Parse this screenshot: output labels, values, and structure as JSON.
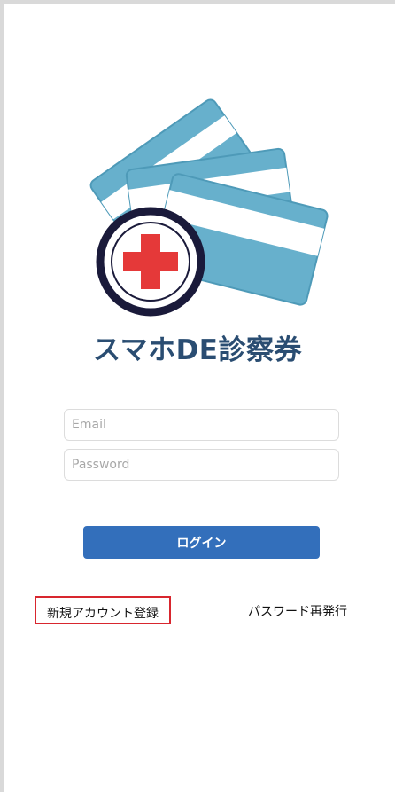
{
  "app": {
    "title": "スマホDE診察券"
  },
  "login_form": {
    "email_placeholder": "Email",
    "password_placeholder": "Password",
    "login_label": "ログイン"
  },
  "links": {
    "register_label": "新規アカウント登録",
    "password_reset_label": "パスワード再発行"
  },
  "colors": {
    "brand_blue": "#336fbb",
    "title_navy": "#2a4d72",
    "card_blue": "#67b0cc",
    "cross_red": "#e53939",
    "highlight_red": "#d8262e"
  },
  "icons": {
    "logo": "medical-card-stack-icon",
    "cross": "red-cross-icon"
  }
}
